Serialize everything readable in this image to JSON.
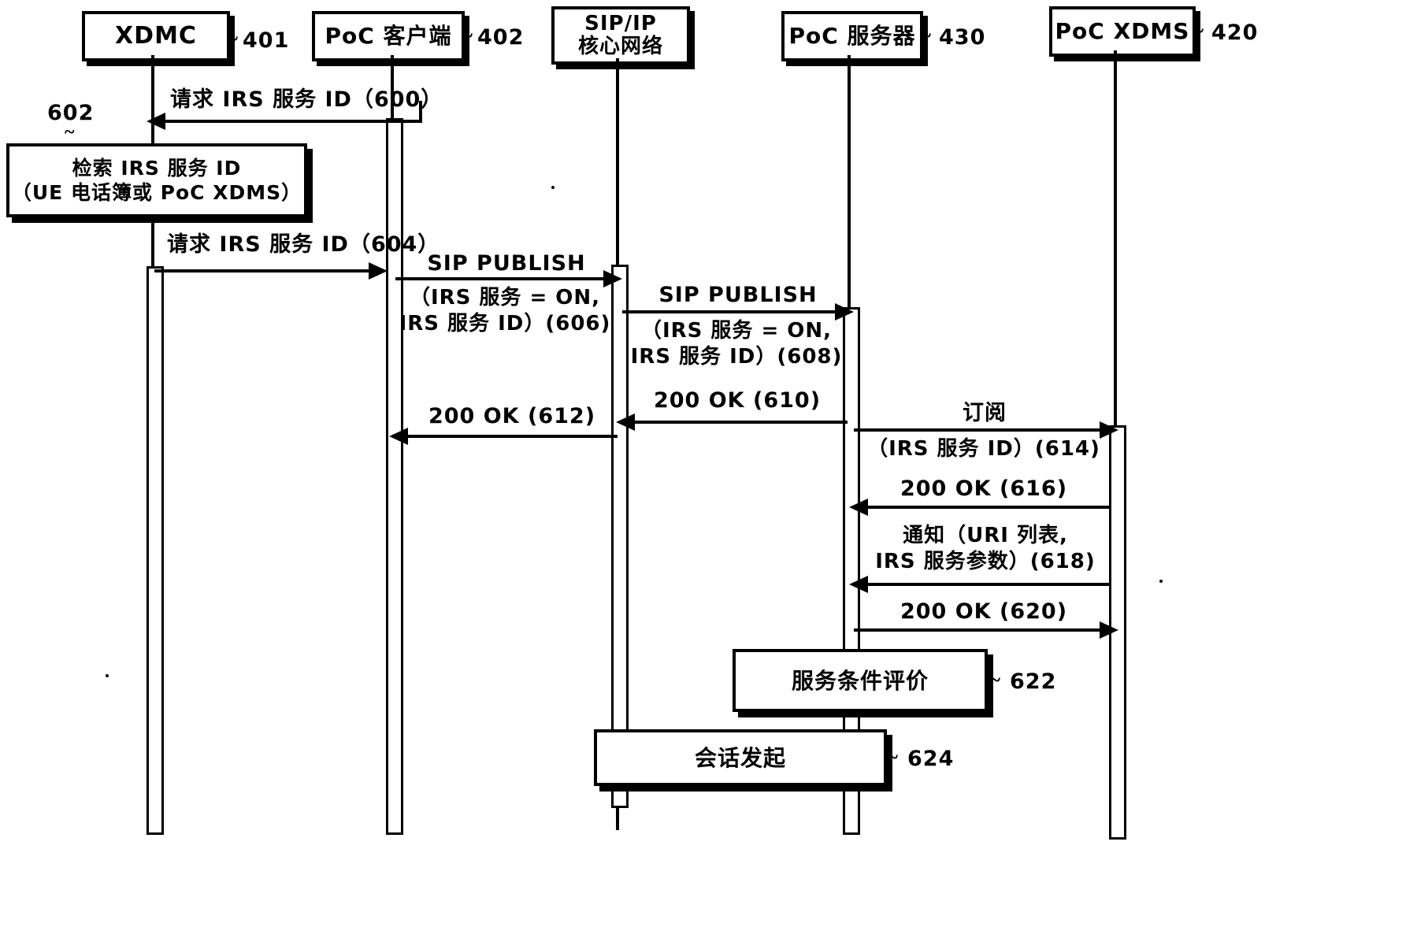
{
  "figure": {
    "type": "sequence-diagram",
    "language": "zh-CN",
    "title": ""
  },
  "actors": [
    {
      "id": "xdmc",
      "label": "XDMC",
      "ref": "401"
    },
    {
      "id": "poc-client",
      "label": "PoC 客户端",
      "ref": "402"
    },
    {
      "id": "sip-core",
      "label": "SIP/IP\n核心网络",
      "ref": ""
    },
    {
      "id": "poc-server",
      "label": "PoC 服务器",
      "ref": "430"
    },
    {
      "id": "poc-xdms",
      "label": "PoC XDMS",
      "ref": "420"
    }
  ],
  "process_boxes": [
    {
      "id": "p602",
      "ref": "602",
      "label": "检索 IRS 服务 ID\n（UE 电话簿或 PoC XDMS）"
    },
    {
      "id": "p622",
      "ref": "622",
      "label": "服务条件评价"
    },
    {
      "id": "p624",
      "ref": "624",
      "label": "会话发起"
    }
  ],
  "messages": [
    {
      "id": "m600",
      "num": "600",
      "label": "请求 IRS 服务 ID（600）",
      "from": "poc-client",
      "to": "xdmc",
      "direction": "left"
    },
    {
      "id": "m604",
      "num": "604",
      "label": "请求 IRS 服务 ID（604）",
      "from": "xdmc",
      "to": "poc-client",
      "direction": "right"
    },
    {
      "id": "m606",
      "num": "606",
      "label": "SIP PUBLISH",
      "sublabel": "（IRS 服务 = ON,\nIRS 服务 ID）(606)",
      "from": "poc-client",
      "to": "sip-core",
      "direction": "right"
    },
    {
      "id": "m608",
      "num": "608",
      "label": "SIP PUBLISH",
      "sublabel": "（IRS 服务 = ON,\nIRS 服务 ID）(608)",
      "from": "sip-core",
      "to": "poc-server",
      "direction": "right"
    },
    {
      "id": "m610",
      "num": "610",
      "label": "200 OK (610)",
      "from": "poc-server",
      "to": "sip-core",
      "direction": "left"
    },
    {
      "id": "m612",
      "num": "612",
      "label": "200 OK (612)",
      "from": "sip-core",
      "to": "poc-client",
      "direction": "left"
    },
    {
      "id": "m614",
      "num": "614",
      "label": "订阅",
      "sublabel": "（IRS 服务 ID）(614)",
      "from": "poc-server",
      "to": "poc-xdms",
      "direction": "right"
    },
    {
      "id": "m616",
      "num": "616",
      "label": "200 OK (616)",
      "from": "poc-xdms",
      "to": "poc-server",
      "direction": "left"
    },
    {
      "id": "m618",
      "num": "618",
      "label": "通知（URI 列表,\nIRS 服务参数）(618)",
      "from": "poc-xdms",
      "to": "poc-server",
      "direction": "left"
    },
    {
      "id": "m620",
      "num": "620",
      "label": "200 OK (620)",
      "from": "poc-server",
      "to": "poc-xdms",
      "direction": "right"
    }
  ],
  "labels": {
    "actor_xdmc": "XDMC",
    "actor_poc_client": "PoC 客户端",
    "actor_sip_core": "SIP/IP\n核心网络",
    "actor_poc_server": "PoC 服务器",
    "actor_poc_xdms": "PoC XDMS",
    "ref_401": "401",
    "ref_402": "402",
    "ref_430": "430",
    "ref_420": "420",
    "ref_602": "602",
    "ref_622": "622",
    "ref_624": "624",
    "box_602": "检索 IRS 服务 ID\n（UE 电话簿或 PoC XDMS）",
    "box_622": "服务条件评价",
    "box_624": "会话发起",
    "msg_600": "请求 IRS 服务 ID（600）",
    "msg_604": "请求 IRS 服务 ID（604）",
    "msg_606_head": "SIP PUBLISH",
    "msg_606_body": "（IRS 服务 = ON,\nIRS 服务 ID）(606)",
    "msg_608_head": "SIP PUBLISH",
    "msg_608_body": "（IRS 服务 = ON,\nIRS 服务 ID）(608)",
    "msg_610": "200 OK (610)",
    "msg_612": "200 OK (612)",
    "msg_614_head": "订阅",
    "msg_614_body": "（IRS 服务 ID）(614)",
    "msg_616": "200 OK (616)",
    "msg_618": "通知（URI 列表,\nIRS 服务参数）(618)",
    "msg_620": "200 OK (620)"
  },
  "colors": {
    "ink": "#000000",
    "paper": "#ffffff"
  }
}
